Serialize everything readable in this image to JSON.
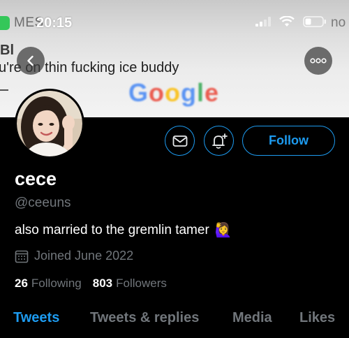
{
  "status_bar": {
    "time": "20:15"
  },
  "banner": {
    "notification_app": "MESSAGES",
    "notification_app_visible": "MES",
    "notification_sender": "Bl",
    "notification_body": "you're on thin fucking ice buddy",
    "notification_right_fragment": "no",
    "background_fragment": "Google"
  },
  "profile": {
    "display_name": "cece",
    "handle": "@ceeuns",
    "bio": "also married to the gremlin tamer",
    "bio_emoji": "🙋‍♀️",
    "joined": "Joined June 2022",
    "following_count": "26",
    "following_label": "Following",
    "followers_count": "803",
    "followers_label": "Followers"
  },
  "actions": {
    "follow_label": "Follow"
  },
  "tabs": [
    {
      "label": "Tweets",
      "active": true
    },
    {
      "label": "Tweets & replies",
      "active": false
    },
    {
      "label": "Media",
      "active": false
    },
    {
      "label": "Likes",
      "active": false
    }
  ],
  "colors": {
    "accent": "#1d9bf0",
    "background": "#000000",
    "secondary_text": "#71767b"
  }
}
